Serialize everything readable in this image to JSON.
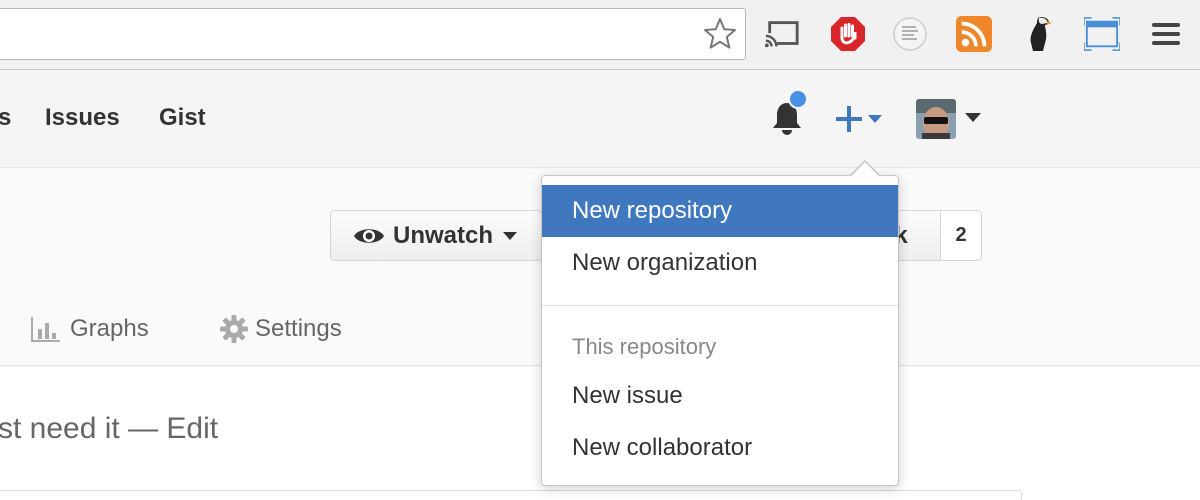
{
  "browser": {
    "extensions": [
      "cast-icon",
      "adblock-icon",
      "notes-icon",
      "rss-icon",
      "eagle-icon",
      "window-icon",
      "menu-icon"
    ]
  },
  "header": {
    "nav": [
      {
        "label": "s"
      },
      {
        "label": "Issues"
      },
      {
        "label": "Gist"
      }
    ]
  },
  "repo": {
    "unwatch_label": "Unwatch",
    "fork_label": "rk",
    "fork_count": "2",
    "tabs": [
      {
        "label": "Graphs"
      },
      {
        "label": "Settings"
      }
    ],
    "description": "st need it —",
    "edit_label": "Edit"
  },
  "dropdown": {
    "items_top": [
      {
        "label": "New repository"
      },
      {
        "label": "New organization"
      }
    ],
    "section_header": "This repository",
    "items_bottom": [
      {
        "label": "New issue"
      },
      {
        "label": "New collaborator"
      }
    ]
  },
  "colors": {
    "accent": "#4078c0",
    "notification_dot": "#4a90e2"
  }
}
